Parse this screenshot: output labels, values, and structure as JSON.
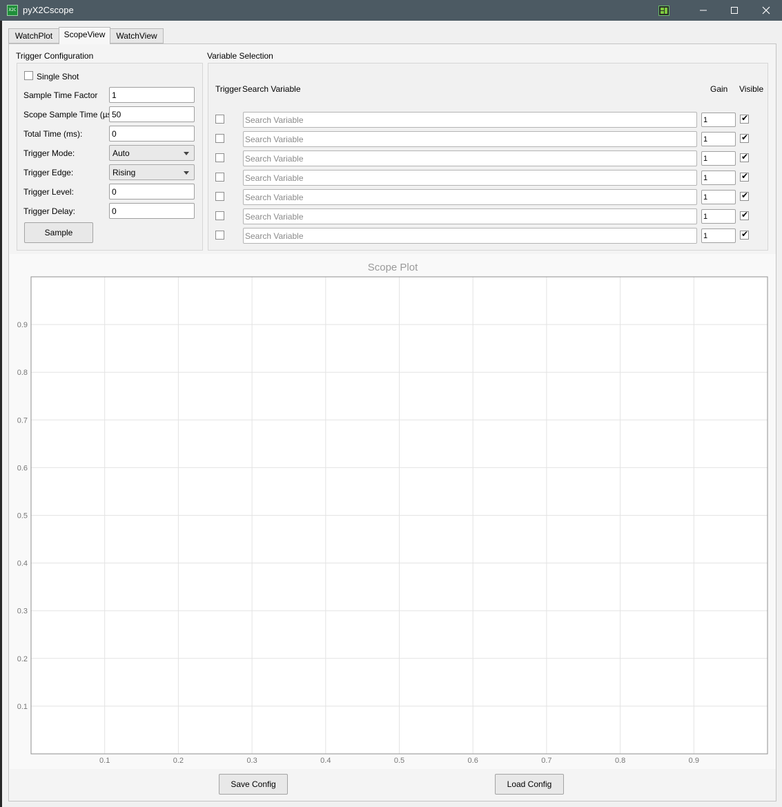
{
  "window": {
    "title": "pyX2Cscope",
    "icon_name": "app-logo-icon",
    "tray_icon": "layout-icon"
  },
  "tabs": [
    {
      "label": "WatchPlot",
      "active": false
    },
    {
      "label": "ScopeView",
      "active": true
    },
    {
      "label": "WatchView",
      "active": false
    }
  ],
  "trigger_config": {
    "title": "Trigger Configuration",
    "single_shot": {
      "label": "Single Shot",
      "checked": false
    },
    "sample_time_factor": {
      "label": "Sample Time Factor",
      "value": "1"
    },
    "scope_sample_time": {
      "label": "Scope Sample Time (µs):",
      "value": "50"
    },
    "total_time": {
      "label": "Total Time (ms):",
      "value": "0"
    },
    "trigger_mode": {
      "label": "Trigger Mode:",
      "value": "Auto"
    },
    "trigger_edge": {
      "label": "Trigger Edge:",
      "value": "Rising"
    },
    "trigger_level": {
      "label": "Trigger Level:",
      "value": "0"
    },
    "trigger_delay": {
      "label": "Trigger Delay:",
      "value": "0"
    },
    "sample_button": "Sample"
  },
  "variable_selection": {
    "title": "Variable Selection",
    "headers": {
      "trigger": "Trigger",
      "search": "Search Variable",
      "gain": "Gain",
      "visible": "Visible"
    },
    "rows": [
      {
        "trigger": false,
        "placeholder": "Search Variable",
        "gain": "1",
        "visible": true
      },
      {
        "trigger": false,
        "placeholder": "Search Variable",
        "gain": "1",
        "visible": true
      },
      {
        "trigger": false,
        "placeholder": "Search Variable",
        "gain": "1",
        "visible": true
      },
      {
        "trigger": false,
        "placeholder": "Search Variable",
        "gain": "1",
        "visible": true
      },
      {
        "trigger": false,
        "placeholder": "Search Variable",
        "gain": "1",
        "visible": true
      },
      {
        "trigger": false,
        "placeholder": "Search Variable",
        "gain": "1",
        "visible": true
      },
      {
        "trigger": false,
        "placeholder": "Search Variable",
        "gain": "1",
        "visible": true
      }
    ]
  },
  "plot": {
    "title": "Scope Plot",
    "x_ticks": [
      "0.1",
      "0.2",
      "0.3",
      "0.4",
      "0.5",
      "0.6",
      "0.7",
      "0.8",
      "0.9"
    ],
    "y_ticks": [
      "0.1",
      "0.2",
      "0.3",
      "0.4",
      "0.5",
      "0.6",
      "0.7",
      "0.8",
      "0.9"
    ],
    "x_range": [
      0,
      1
    ],
    "y_range": [
      0,
      1
    ],
    "grid": true
  },
  "footer": {
    "save_label": "Save Config",
    "load_label": "Load Config"
  },
  "colors": {
    "titlebar": "#4c5a63",
    "grid": "#e3e3e3",
    "axis_text": "#777777"
  }
}
